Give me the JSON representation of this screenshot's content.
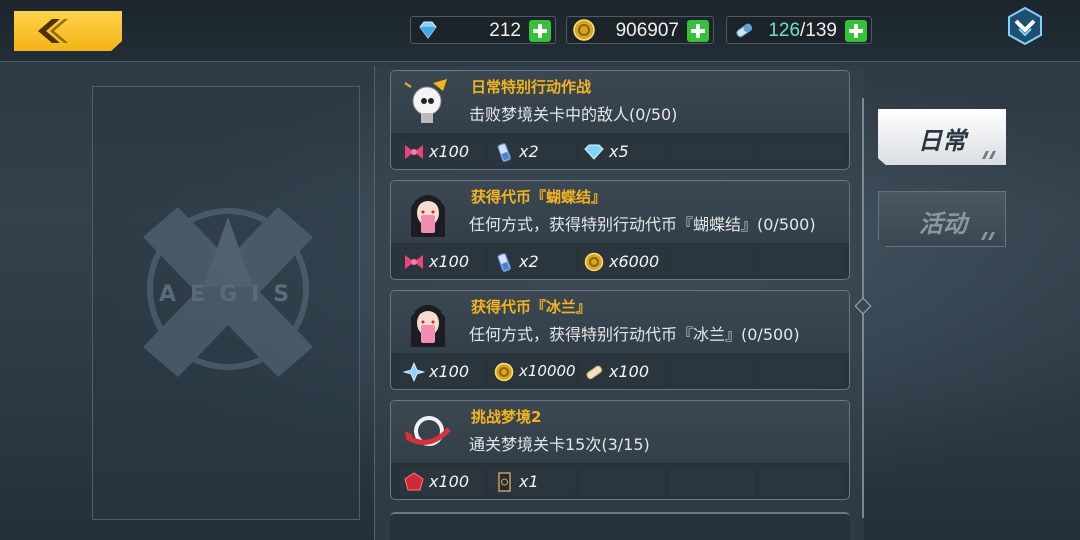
{
  "topbar": {
    "resources": [
      {
        "icon": "gem-icon",
        "value": "212"
      },
      {
        "icon": "coin-icon",
        "value": "906907"
      },
      {
        "icon": "stamina-icon",
        "current": "126",
        "max": "/139"
      }
    ]
  },
  "emblem": {
    "text": "AEGIS"
  },
  "tabs": [
    {
      "label": "日常",
      "active": true
    },
    {
      "label": "活动",
      "active": false
    }
  ],
  "missions": [
    {
      "icon": "lightbulb-icon",
      "title": "日常特别行动作战",
      "desc": "击败梦境关卡中的敌人(0/50)",
      "rewards": [
        {
          "icon": "bow-icon",
          "qty": "x100"
        },
        {
          "icon": "potion-icon",
          "qty": "x2"
        },
        {
          "icon": "gem-icon",
          "qty": "x5"
        }
      ]
    },
    {
      "icon": "character-portrait-icon",
      "title": "获得代币『蝴蝶结』",
      "desc": "任何方式，获得特别行动代币『蝴蝶结』(0/500)",
      "rewards": [
        {
          "icon": "bow-icon",
          "qty": "x100"
        },
        {
          "icon": "potion-icon",
          "qty": "x2"
        },
        {
          "icon": "coin-icon",
          "qty": "x6000"
        }
      ]
    },
    {
      "icon": "character-portrait-icon",
      "title": "获得代币『冰兰』",
      "desc": "任何方式，获得特别行动代币『冰兰』(0/500)",
      "rewards": [
        {
          "icon": "ice-crystal-icon",
          "qty": "x100"
        },
        {
          "icon": "coin-icon",
          "qty": "x10000"
        },
        {
          "icon": "stamina-icon",
          "qty": "x100"
        }
      ]
    },
    {
      "icon": "dream-ring-icon",
      "title": "挑战梦境2",
      "desc": "通关梦境关卡15次(3/15)",
      "rewards": [
        {
          "icon": "red-gem-icon",
          "qty": "x100"
        },
        {
          "icon": "card-icon",
          "qty": "x1"
        }
      ]
    }
  ]
}
